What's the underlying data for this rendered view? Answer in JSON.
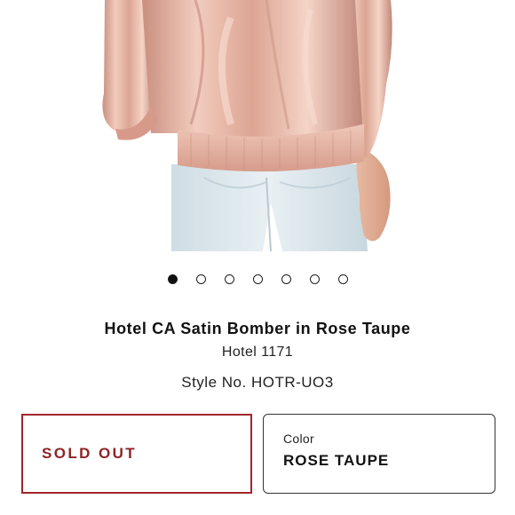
{
  "product": {
    "title": "Hotel CA Satin Bomber in Rose Taupe",
    "brand": "Hotel 1171",
    "style_number": "Style No. HOTR-UO3"
  },
  "gallery": {
    "image_description": "product-photo-satin-bomber",
    "dots_total": 7,
    "active_index": 0
  },
  "actions": {
    "status_label": "SOLD OUT"
  },
  "color_selector": {
    "label": "Color",
    "value": "ROSE TAUPE"
  },
  "colors": {
    "sold_out_accent": "#a0262a",
    "satin": "#e7b8a6",
    "denim": "#dfe9ee"
  }
}
